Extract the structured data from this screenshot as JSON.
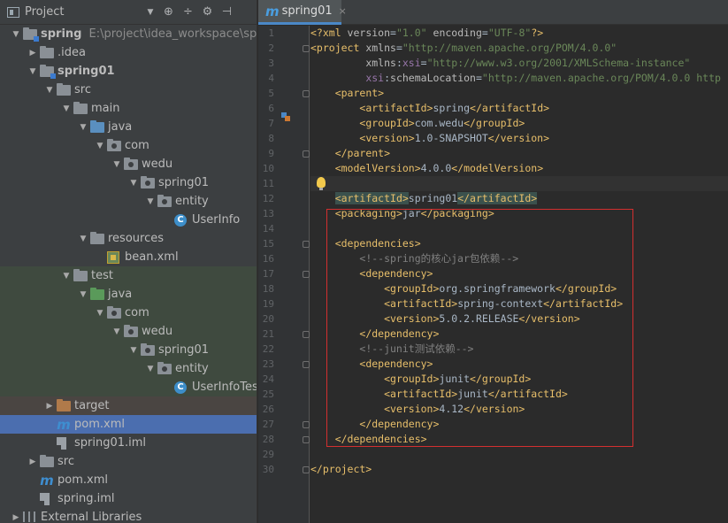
{
  "project_panel": {
    "title": "Project",
    "tools": [
      "⊕",
      "÷",
      "⚙",
      "⊣"
    ],
    "tree": [
      {
        "label": "spring",
        "path": "E:\\project\\idea_workspace\\spring",
        "depth": 0,
        "expanded": true,
        "icon": "module-folder-icon",
        "bold": true,
        "row": "normal"
      },
      {
        "label": ".idea",
        "depth": 1,
        "expanded": false,
        "icon": "folder-icon",
        "row": "normal"
      },
      {
        "label": "spring01",
        "depth": 1,
        "expanded": true,
        "icon": "module-folder-icon",
        "bold": true,
        "row": "normal"
      },
      {
        "label": "src",
        "depth": 2,
        "expanded": true,
        "icon": "folder-icon",
        "row": "normal"
      },
      {
        "label": "main",
        "depth": 3,
        "expanded": true,
        "icon": "folder-icon",
        "row": "normal"
      },
      {
        "label": "java",
        "depth": 4,
        "expanded": true,
        "icon": "source-folder-icon",
        "row": "normal"
      },
      {
        "label": "com",
        "depth": 5,
        "expanded": true,
        "icon": "package-icon",
        "row": "normal"
      },
      {
        "label": "wedu",
        "depth": 6,
        "expanded": true,
        "icon": "package-icon",
        "row": "normal"
      },
      {
        "label": "spring01",
        "depth": 7,
        "expanded": true,
        "icon": "package-icon",
        "row": "normal"
      },
      {
        "label": "entity",
        "depth": 8,
        "expanded": true,
        "icon": "package-icon",
        "row": "normal"
      },
      {
        "label": "UserInfo",
        "depth": 9,
        "icon": "class-icon",
        "row": "normal"
      },
      {
        "label": "resources",
        "depth": 4,
        "expanded": true,
        "icon": "resources-folder-icon",
        "row": "normal"
      },
      {
        "label": "bean.xml",
        "depth": 5,
        "icon": "xml-file-icon",
        "row": "normal"
      },
      {
        "label": "test",
        "depth": 3,
        "expanded": true,
        "icon": "folder-icon",
        "row": "test"
      },
      {
        "label": "java",
        "depth": 4,
        "expanded": true,
        "icon": "test-folder-icon",
        "row": "test"
      },
      {
        "label": "com",
        "depth": 5,
        "expanded": true,
        "icon": "package-icon",
        "row": "test"
      },
      {
        "label": "wedu",
        "depth": 6,
        "expanded": true,
        "icon": "package-icon",
        "row": "test"
      },
      {
        "label": "spring01",
        "depth": 7,
        "expanded": true,
        "icon": "package-icon",
        "row": "test"
      },
      {
        "label": "entity",
        "depth": 8,
        "expanded": true,
        "icon": "package-icon",
        "row": "test"
      },
      {
        "label": "UserInfoTest",
        "depth": 9,
        "icon": "class-icon",
        "row": "test"
      },
      {
        "label": "target",
        "depth": 2,
        "expanded": false,
        "icon": "excluded-folder-icon",
        "row": "target"
      },
      {
        "label": "pom.xml",
        "depth": 2,
        "icon": "maven-file-icon",
        "row": "selected"
      },
      {
        "label": "spring01.iml",
        "depth": 2,
        "icon": "iml-file-icon",
        "row": "normal"
      },
      {
        "label": "src",
        "depth": 1,
        "expanded": false,
        "icon": "folder-icon",
        "row": "normal"
      },
      {
        "label": "pom.xml",
        "depth": 1,
        "icon": "maven-file-icon",
        "row": "normal"
      },
      {
        "label": "spring.iml",
        "depth": 1,
        "icon": "iml-file-icon",
        "row": "normal"
      },
      {
        "label": "External Libraries",
        "depth": 0,
        "expanded": false,
        "icon": "library-icon",
        "row": "normal"
      }
    ]
  },
  "editor": {
    "tab": {
      "label": "spring01",
      "close": "×"
    },
    "lines": [
      {
        "n": "1",
        "tokens": [
          [
            "t-tag",
            "<?xml "
          ],
          [
            "t-attr",
            "version"
          ],
          [
            "t-txt",
            "="
          ],
          [
            "t-val",
            "\"1.0\""
          ],
          [
            "t-txt",
            " "
          ],
          [
            "t-attr",
            "encoding"
          ],
          [
            "t-txt",
            "="
          ],
          [
            "t-val",
            "\"UTF-8\""
          ],
          [
            "t-tag",
            "?>"
          ]
        ]
      },
      {
        "n": "2",
        "fold": true,
        "tokens": [
          [
            "t-tag",
            "<project "
          ],
          [
            "t-attr",
            "xmlns"
          ],
          [
            "t-txt",
            "="
          ],
          [
            "t-val",
            "\"http://maven.apache.org/POM/4.0.0\""
          ]
        ]
      },
      {
        "n": "3",
        "tokens": [
          [
            "t-txt",
            "         "
          ],
          [
            "t-attr",
            "xmlns"
          ],
          [
            "t-txt",
            ":"
          ],
          [
            "t-ns",
            "xsi"
          ],
          [
            "t-txt",
            "="
          ],
          [
            "t-val",
            "\"http://www.w3.org/2001/XMLSchema-instance\""
          ]
        ]
      },
      {
        "n": "4",
        "tokens": [
          [
            "t-txt",
            "         "
          ],
          [
            "t-ns",
            "xsi"
          ],
          [
            "t-txt",
            ":"
          ],
          [
            "t-attr",
            "schemaLocation"
          ],
          [
            "t-txt",
            "="
          ],
          [
            "t-val",
            "\"http://maven.apache.org/POM/4.0.0 http"
          ]
        ]
      },
      {
        "n": "5",
        "fold": true,
        "tokens": [
          [
            "t-txt",
            "    "
          ],
          [
            "t-tag",
            "<parent>"
          ]
        ]
      },
      {
        "n": "6",
        "tokens": [
          [
            "t-txt",
            "        "
          ],
          [
            "t-tag",
            "<artifactId>"
          ],
          [
            "t-txt",
            "spring"
          ],
          [
            "t-tag",
            "</artifactId>"
          ]
        ]
      },
      {
        "n": "7",
        "tokens": [
          [
            "t-txt",
            "        "
          ],
          [
            "t-tag",
            "<groupId>"
          ],
          [
            "t-txt",
            "com.wedu"
          ],
          [
            "t-tag",
            "</groupId>"
          ]
        ]
      },
      {
        "n": "8",
        "tokens": [
          [
            "t-txt",
            "        "
          ],
          [
            "t-tag",
            "<version>"
          ],
          [
            "t-txt",
            "1.0-SNAPSHOT"
          ],
          [
            "t-tag",
            "</version>"
          ]
        ]
      },
      {
        "n": "9",
        "fold": true,
        "tokens": [
          [
            "t-txt",
            "    "
          ],
          [
            "t-tag",
            "</parent>"
          ]
        ]
      },
      {
        "n": "10",
        "tokens": [
          [
            "t-txt",
            "    "
          ],
          [
            "t-tag",
            "<modelVersion>"
          ],
          [
            "t-txt",
            "4.0.0"
          ],
          [
            "t-tag",
            "</modelVersion>"
          ]
        ]
      },
      {
        "n": "11",
        "caret": true,
        "tokens": [
          [
            "t-txt",
            ""
          ]
        ]
      },
      {
        "n": "12",
        "tokens": [
          [
            "t-txt",
            "    "
          ],
          [
            "t-tag t-hl",
            "<artifactId>"
          ],
          [
            "t-txt",
            "spring01"
          ],
          [
            "t-tag t-hl",
            "</artifactId>"
          ]
        ]
      },
      {
        "n": "13",
        "tokens": [
          [
            "t-txt",
            "    "
          ],
          [
            "t-tag",
            "<packaging>"
          ],
          [
            "t-txt",
            "jar"
          ],
          [
            "t-tag",
            "</packaging>"
          ]
        ]
      },
      {
        "n": "14",
        "tokens": [
          [
            "t-txt",
            ""
          ]
        ]
      },
      {
        "n": "15",
        "fold": true,
        "tokens": [
          [
            "t-txt",
            "    "
          ],
          [
            "t-tag",
            "<dependencies>"
          ]
        ]
      },
      {
        "n": "16",
        "tokens": [
          [
            "t-txt",
            "        "
          ],
          [
            "t-com",
            "<!--spring的核心jar包依赖-->"
          ]
        ]
      },
      {
        "n": "17",
        "fold": true,
        "tokens": [
          [
            "t-txt",
            "        "
          ],
          [
            "t-tag",
            "<dependency>"
          ]
        ]
      },
      {
        "n": "18",
        "tokens": [
          [
            "t-txt",
            "            "
          ],
          [
            "t-tag",
            "<groupId>"
          ],
          [
            "t-txt",
            "org.springframework"
          ],
          [
            "t-tag",
            "</groupId>"
          ]
        ]
      },
      {
        "n": "19",
        "tokens": [
          [
            "t-txt",
            "            "
          ],
          [
            "t-tag",
            "<artifactId>"
          ],
          [
            "t-txt",
            "spring-context"
          ],
          [
            "t-tag",
            "</artifactId>"
          ]
        ]
      },
      {
        "n": "20",
        "tokens": [
          [
            "t-txt",
            "            "
          ],
          [
            "t-tag",
            "<version>"
          ],
          [
            "t-txt",
            "5.0.2.RELEASE"
          ],
          [
            "t-tag",
            "</version>"
          ]
        ]
      },
      {
        "n": "21",
        "fold": true,
        "tokens": [
          [
            "t-txt",
            "        "
          ],
          [
            "t-tag",
            "</dependency>"
          ]
        ]
      },
      {
        "n": "22",
        "tokens": [
          [
            "t-txt",
            "        "
          ],
          [
            "t-com",
            "<!--junit测试依赖-->"
          ]
        ]
      },
      {
        "n": "23",
        "fold": true,
        "tokens": [
          [
            "t-txt",
            "        "
          ],
          [
            "t-tag",
            "<dependency>"
          ]
        ]
      },
      {
        "n": "24",
        "tokens": [
          [
            "t-txt",
            "            "
          ],
          [
            "t-tag",
            "<groupId>"
          ],
          [
            "t-txt",
            "junit"
          ],
          [
            "t-tag",
            "</groupId>"
          ]
        ]
      },
      {
        "n": "25",
        "tokens": [
          [
            "t-txt",
            "            "
          ],
          [
            "t-tag",
            "<artifactId>"
          ],
          [
            "t-txt",
            "junit"
          ],
          [
            "t-tag",
            "</artifactId>"
          ]
        ]
      },
      {
        "n": "26",
        "tokens": [
          [
            "t-txt",
            "            "
          ],
          [
            "t-tag",
            "<version>"
          ],
          [
            "t-txt",
            "4.12"
          ],
          [
            "t-tag",
            "</version>"
          ]
        ]
      },
      {
        "n": "27",
        "fold": true,
        "tokens": [
          [
            "t-txt",
            "        "
          ],
          [
            "t-tag",
            "</dependency>"
          ]
        ]
      },
      {
        "n": "28",
        "fold": true,
        "tokens": [
          [
            "t-txt",
            "    "
          ],
          [
            "t-tag",
            "</dependencies>"
          ]
        ]
      },
      {
        "n": "29",
        "tokens": [
          [
            "t-txt",
            ""
          ]
        ]
      },
      {
        "n": "30",
        "fold": true,
        "tokens": [
          [
            "t-tag",
            "</project>"
          ]
        ]
      }
    ]
  },
  "colors": {
    "annotation_box": "#d32f2f",
    "selection": "#4b6eaf",
    "tag": "#e8bf6a",
    "string": "#6a8759",
    "comment": "#808080"
  }
}
